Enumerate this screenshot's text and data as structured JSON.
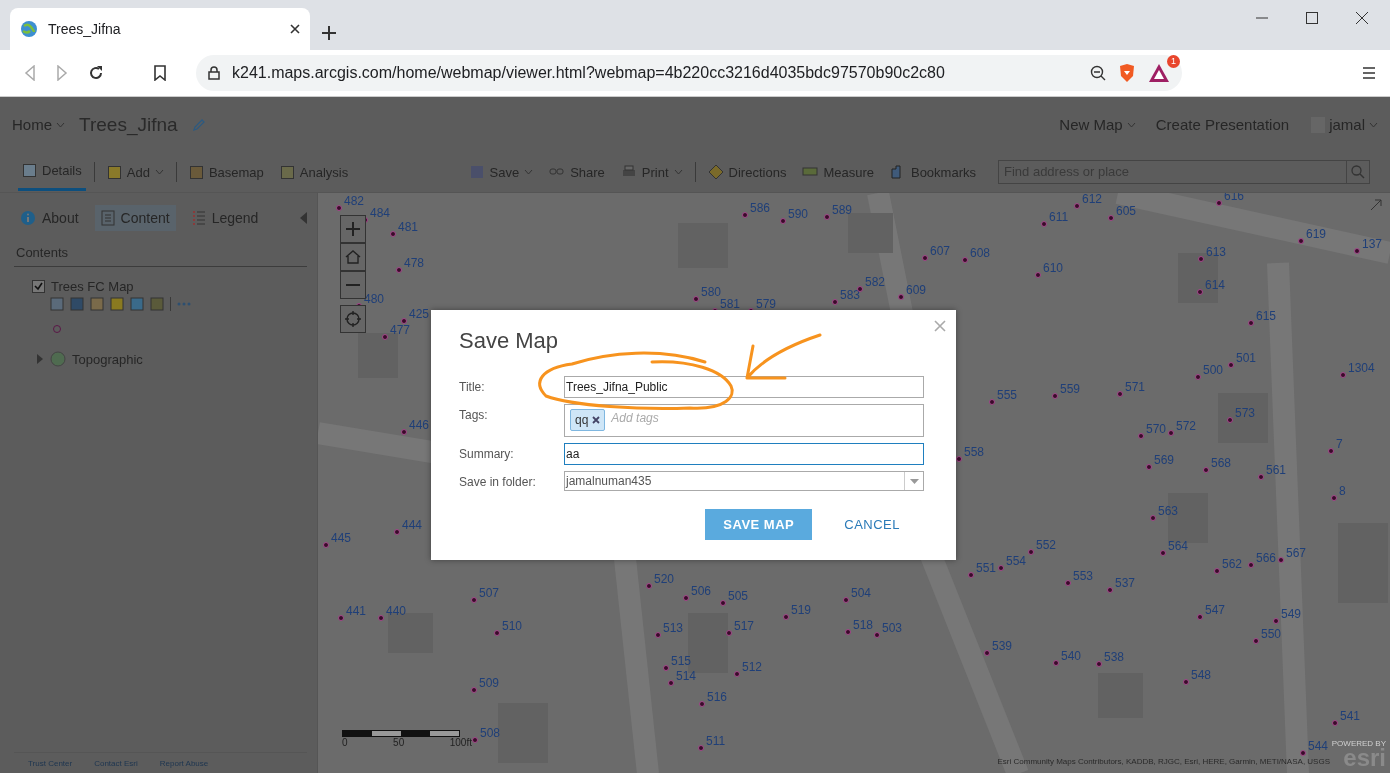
{
  "browser": {
    "tab_title": "Trees_Jifna",
    "url": "k241.maps.arcgis.com/home/webmap/viewer.html?webmap=4b220cc3216d4035bdc97570b90c2c80",
    "extension_badge": "1"
  },
  "header": {
    "home": "Home",
    "map_title": "Trees_Jifna",
    "right_items": [
      "New Map",
      "Create Presentation"
    ],
    "user": "jamal"
  },
  "toolbar": {
    "left": [
      {
        "label": "Details",
        "selected": true,
        "has_menu": false
      },
      {
        "label": "Add",
        "selected": false,
        "has_menu": true
      },
      {
        "label": "Basemap",
        "selected": false,
        "has_menu": false
      },
      {
        "label": "Analysis",
        "selected": false,
        "has_menu": false
      }
    ],
    "right": [
      {
        "label": "Save",
        "has_menu": true
      },
      {
        "label": "Share",
        "has_menu": false
      },
      {
        "label": "Print",
        "has_menu": true
      },
      {
        "label": "Directions",
        "has_menu": false
      },
      {
        "label": "Measure",
        "has_menu": false
      },
      {
        "label": "Bookmarks",
        "has_menu": false
      }
    ],
    "search_placeholder": "Find address or place"
  },
  "panel": {
    "tabs": [
      {
        "label": "About",
        "selected": false
      },
      {
        "label": "Content",
        "selected": true
      },
      {
        "label": "Legend",
        "selected": false
      }
    ],
    "heading": "Contents",
    "layers": [
      {
        "kind": "feature",
        "name": "Trees FC Map",
        "checked": true
      },
      {
        "kind": "basemap",
        "name": "Topographic",
        "expanded": false
      }
    ],
    "footer_links": [
      "Trust Center",
      "Contact Esri",
      "Report Abuse"
    ]
  },
  "map": {
    "points": [
      "482",
      "484",
      "481",
      "478",
      "480",
      "477",
      "425",
      "586",
      "590",
      "589",
      "612",
      "605",
      "611",
      "616",
      "619",
      "137",
      "607",
      "608",
      "610",
      "613",
      "580",
      "581",
      "579",
      "583",
      "582",
      "609",
      "614",
      "615",
      "501",
      "500",
      "1304",
      "555",
      "559",
      "571",
      "573",
      "570",
      "572",
      "7",
      "569",
      "568",
      "561",
      "558",
      "8",
      "563",
      "446",
      "445",
      "444",
      "552",
      "564",
      "554",
      "551",
      "567",
      "566",
      "562",
      "553",
      "537",
      "507",
      "520",
      "506",
      "505",
      "504",
      "441",
      "440",
      "519",
      "547",
      "549",
      "550",
      "510",
      "513",
      "517",
      "518",
      "503",
      "515",
      "512",
      "514",
      "539",
      "540",
      "538",
      "548",
      "509",
      "516",
      "541",
      "508",
      "511",
      "544"
    ],
    "scale_labels": [
      "0",
      "50",
      "100ft"
    ],
    "attribution": "Esri Community Maps Contributors, KADDB, RJGC, Esri, HERE, Garmin, METI/NASA, USGS",
    "logo_caption": "POWERED BY",
    "logo": "esri"
  },
  "dialog": {
    "title": "Save Map",
    "fields": [
      {
        "kind": "text",
        "label": "Title:",
        "value": "Trees_Jifna_Public",
        "focused": false
      },
      {
        "kind": "tags",
        "label": "Tags:",
        "tags": [
          "qq"
        ],
        "placeholder": "Add tags"
      },
      {
        "kind": "text",
        "label": "Summary:",
        "value": "aa",
        "focused": true
      },
      {
        "kind": "select",
        "label": "Save in folder:",
        "value": "jamalnuman435"
      }
    ],
    "primary": "SAVE MAP",
    "secondary": "CANCEL"
  }
}
